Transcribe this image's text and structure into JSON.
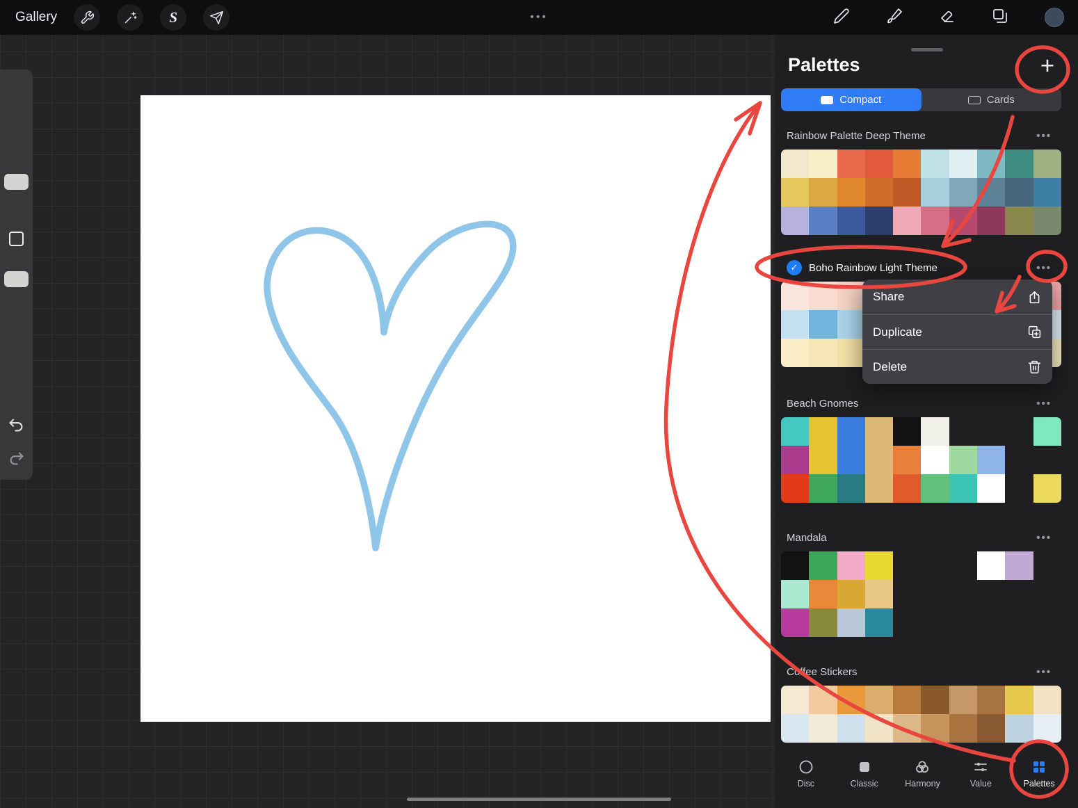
{
  "topbar": {
    "gallery_label": "Gallery",
    "center_dots": "•••"
  },
  "glyphs": {
    "ellipsis": "•••",
    "plus": "+",
    "check": "✓"
  },
  "canvas": {
    "drawing": "heart",
    "heart_color": "#8fc5e8"
  },
  "panel": {
    "title": "Palettes",
    "segmented": {
      "compact": "Compact",
      "cards": "Cards",
      "selected": "Compact"
    },
    "context_menu": {
      "items": [
        {
          "label": "Share",
          "icon": "share-icon"
        },
        {
          "label": "Duplicate",
          "icon": "duplicate-icon"
        },
        {
          "label": "Delete",
          "icon": "delete-icon"
        }
      ]
    },
    "palettes": [
      {
        "name": "Rainbow Palette Deep Theme",
        "selected": false,
        "rows": [
          [
            "#f2e9cc",
            "#f8f0c9",
            "#e96a4a",
            "#e25a3b",
            "#e87c34",
            "#c1e1e8",
            "#deeef2",
            "#7fb9c3",
            "#3f8d83",
            "#9fb083"
          ],
          [
            "#e6c85d",
            "#dba842",
            "#df882e",
            "#ce6d2a",
            "#c15927",
            "#a8cedd",
            "#81a8ba",
            "#5e8298",
            "#46677c",
            "#3d7ea5"
          ],
          [
            "#b6b2dd",
            "#5b7fc5",
            "#3a5a9d",
            "#2c3e6d",
            "#f1a9b8",
            "#d86d87",
            "#b7496f",
            "#8d395b",
            "#89894d",
            "#79896d"
          ]
        ]
      },
      {
        "name": "Boho Rainbow Light Theme",
        "selected": true,
        "rows": [
          [
            "#fae5dc",
            "#f8dcd0",
            "#f6d3c5",
            "#f4cab9",
            "#f2c1ae",
            "#f0b8a3",
            "#eeb098",
            "#f3c4b4",
            "#f7d6c9",
            "#f2a9ab"
          ],
          [
            "#c6e1f1",
            "#71b4dc",
            "#aad5ec",
            "#8dc5e5",
            "#bedff1",
            "#d4eaf6",
            "#9ecee8",
            "#83bee1",
            "#c8e3f2",
            "#ddeff8"
          ],
          [
            "#fbeec7",
            "#f8e8b7",
            "#f6e2a7",
            "#f4dd98",
            "#f2d889",
            "#f0d37a",
            "#eece6b",
            "#ebc95c",
            "#f5e5af",
            "#f8ecc1"
          ]
        ]
      },
      {
        "name": "Beach Gnomes",
        "selected": false,
        "rows": [
          [
            "#45c8bf",
            "#e6c431",
            "#3b7de1",
            "#ddb977",
            "#121212",
            "#f0f0e9",
            null,
            null,
            null,
            "#7fe8c0"
          ],
          [
            "#a93a8c",
            "#e6c431",
            "#3b7de1",
            "#ddb977",
            "#e8803a",
            "#ffffff",
            "#9fd9a0",
            "#8fb4e8",
            null,
            null
          ],
          [
            "#e33a1a",
            "#3fa85c",
            "#2a7a85",
            "#ddb977",
            "#e05a2a",
            "#62c07a",
            "#3cc4b4",
            "#ffffff",
            null,
            "#ecd95e"
          ]
        ]
      },
      {
        "name": "Mandala",
        "selected": false,
        "rows": [
          [
            "#121212",
            "#3aa75b",
            "#f1aac8",
            "#e7d932",
            null,
            null,
            null,
            "#ffffff",
            "#c2a9d5",
            null
          ],
          [
            "#a8e9cf",
            "#e8893a",
            "#d8a833",
            "#e8c883",
            null,
            null,
            null,
            null,
            null,
            null
          ],
          [
            "#b73a9e",
            "#89893a",
            "#b8c8d9",
            "#2a899f",
            null,
            null,
            null,
            null,
            null,
            null
          ]
        ]
      },
      {
        "name": "Coffee Stickers",
        "selected": false,
        "rows": [
          [
            "#f5e9d1",
            "#f1ca9f",
            "#e9993b",
            "#dbad6d",
            "#b97a3b",
            "#89592a",
            "#c79969",
            "#a77343",
            "#e8c84b",
            "#f1e2c3"
          ],
          [
            "#d8e7f1",
            "#f3ebd7",
            "#cee0ec",
            "#f1e3c5",
            "#dbb887",
            "#c5945d",
            "#a8733e",
            "#895932",
            "#bed4e3",
            "#e7eff5"
          ],
          [
            "#f3e7cf",
            "#e7cfa7",
            "#d8b480",
            "#c6995e",
            "#af7b41",
            "#98622e",
            "#834f25",
            "#6e3e1d",
            "#d3c1a3",
            "#eee4d1"
          ]
        ]
      }
    ],
    "tabbar": [
      {
        "label": "Disc"
      },
      {
        "label": "Classic"
      },
      {
        "label": "Harmony"
      },
      {
        "label": "Value"
      },
      {
        "label": "Palettes"
      }
    ],
    "active_tab": "Palettes"
  },
  "colors": {
    "accent_blue": "#2f7cf6",
    "annotation_red": "#e8463e",
    "heart_blue": "#8fc5e8",
    "selected_check_blue": "#1d7bf5"
  }
}
